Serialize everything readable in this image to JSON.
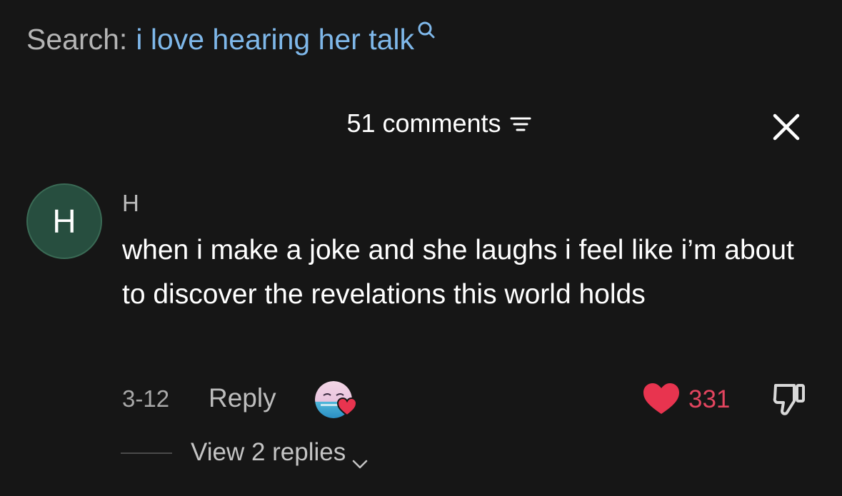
{
  "search": {
    "label": "Search:",
    "query": "i love hearing her talk",
    "icon": "search-icon"
  },
  "comments_header": {
    "count_label": "51 comments",
    "sort_icon": "sort-icon",
    "close_icon": "close-icon"
  },
  "comment": {
    "avatar_letter": "H",
    "username": "H",
    "text": "when i make a joke and she laughs i feel like i’m about to discover the revelations this world holds",
    "date": "3-12",
    "reply_label": "Reply",
    "liked_by_creator": true,
    "likes": "331",
    "view_replies_label": "View 2 replies"
  },
  "colors": {
    "background": "#161616",
    "search_query": "#7fb8ea",
    "like": "#e8344f",
    "avatar_bg": "#274e3f"
  }
}
